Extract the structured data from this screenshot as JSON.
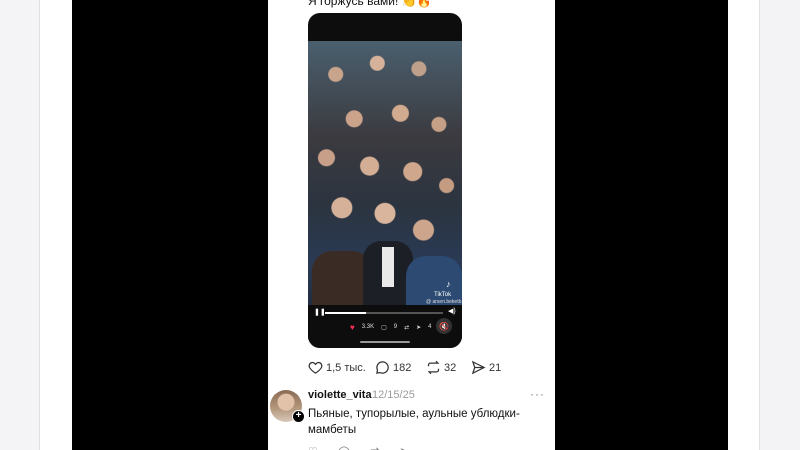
{
  "post": {
    "caption": "Я горжусь вами! 👏🔥"
  },
  "video": {
    "tiktok_logo": "♪",
    "tiktok_label": "TikTok",
    "tiktok_handle": "@ arsen.beketb",
    "progress": 0.35,
    "inner_likes": "3.3K",
    "inner_comments": "9",
    "inner_shares": "4"
  },
  "actions": {
    "likes": "1,5 тыс.",
    "comments": "182",
    "reposts": "32",
    "shares": "21"
  },
  "comment": {
    "username": "violette_vita",
    "date": "12/15/25",
    "text": "Пьяные, тупорылые, аульные ублюдки-мамбеты",
    "more": "···"
  },
  "icons": {
    "like": "heart-icon",
    "comment": "comment-icon",
    "repost": "repost-icon",
    "share": "share-icon"
  }
}
